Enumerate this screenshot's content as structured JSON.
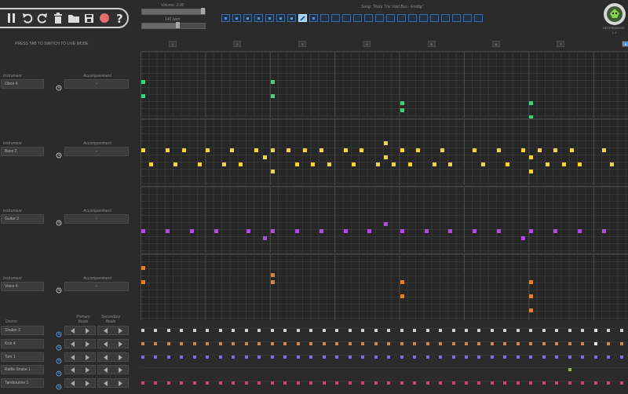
{
  "toolbar": {
    "icons": [
      "pause-icon",
      "undo-icon",
      "redo-icon",
      "trash-icon",
      "folder-icon",
      "save-icon",
      "record-icon",
      "help-icon"
    ]
  },
  "volume": {
    "label": "Volume: 2.00",
    "fraction": 0.98
  },
  "tempo": {
    "label": "140 bpm",
    "fraction": 0.58
  },
  "song": {
    "title": "Song: \"Rock The Void Bus - Endfig\"",
    "patterns": 24,
    "filled_count": 7,
    "selected_index": 7
  },
  "logo": {
    "line1": "DETERMINOID",
    "line2": "L.J"
  },
  "live_mode_hint": "PRESS TAB TO SWITCH TO LIVE MODE",
  "measures": [
    "1",
    "2",
    "3",
    "4",
    "5",
    "6",
    "7",
    "8"
  ],
  "instruments": [
    {
      "label": "Instrument",
      "name": "Oboe 4",
      "acc_label": "Accompaniment",
      "acc_value": "-",
      "color": "#3fd17d"
    },
    {
      "label": "Instrument",
      "name": "Bass 2",
      "acc_label": "Accompaniment",
      "acc_value": "-",
      "color": "#f1d63a"
    },
    {
      "label": "Instrument",
      "name": "Guitar 3",
      "acc_label": "Accompaniment",
      "acc_value": "-",
      "color": "#b04be6"
    },
    {
      "label": "Instrument",
      "name": "Voice 4",
      "acc_label": "Accompaniment",
      "acc_value": "-",
      "color": "#e0822c"
    }
  ],
  "drums_header": {
    "label": "Drums",
    "primary": "Primary Beats",
    "secondary": "Secondary Beats"
  },
  "drums": [
    {
      "name": "Shaker 2",
      "color": "#cfcfcf"
    },
    {
      "name": "Kick 4",
      "color": "#d08a4a"
    },
    {
      "name": "Tom 1",
      "color": "#7b6fe0"
    },
    {
      "name": "Rattle Snake 1",
      "color": "#8fb84a"
    },
    {
      "name": "Tambourine 1",
      "color": "#d0427a"
    }
  ]
}
